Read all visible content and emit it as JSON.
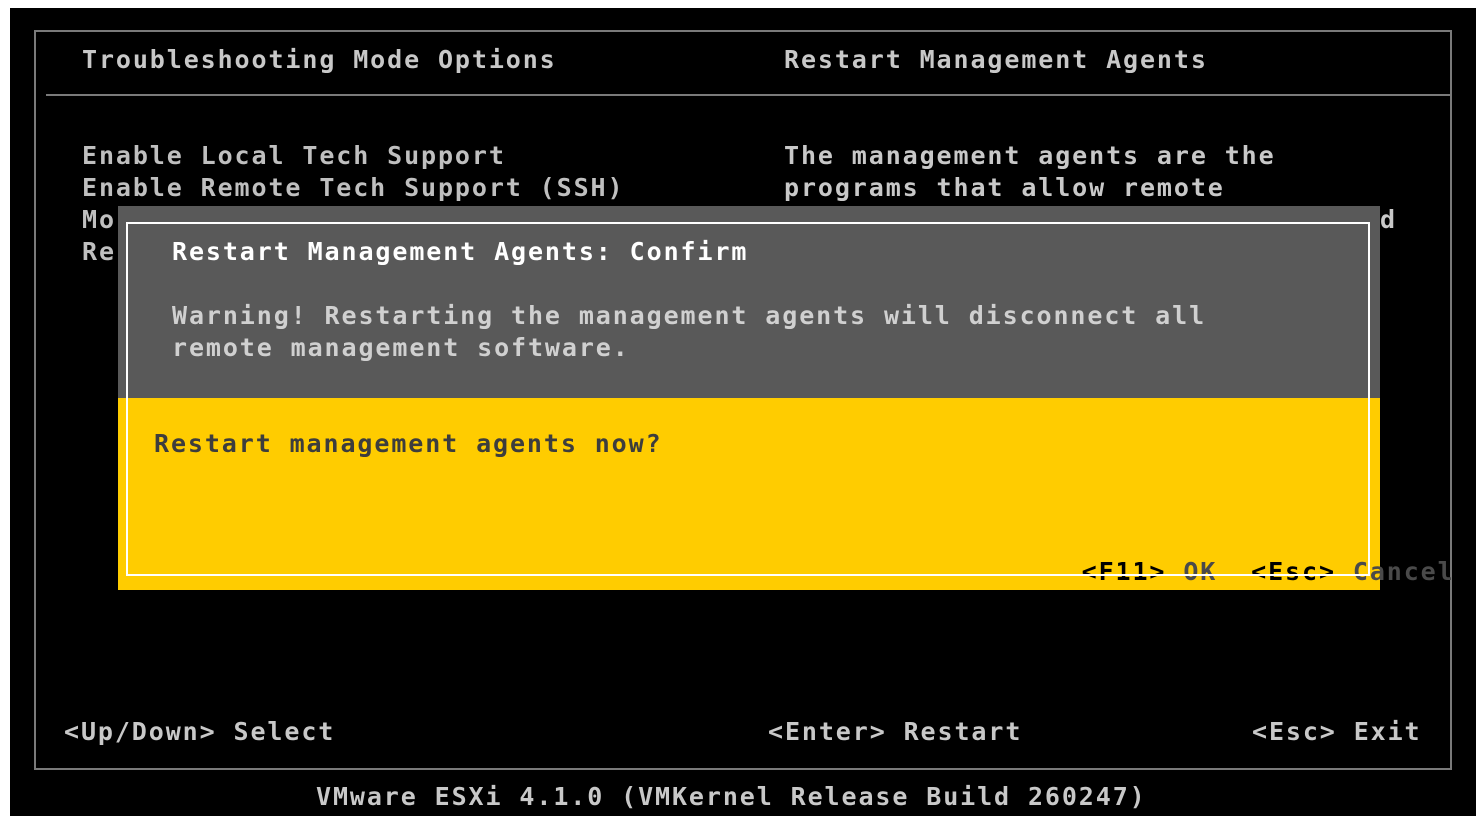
{
  "header": {
    "left_title": "Troubleshooting Mode Options",
    "right_title": "Restart Management Agents"
  },
  "menu": {
    "items": [
      {
        "label": "Enable Local Tech Support"
      },
      {
        "label": "Enable Remote Tech Support (SSH)"
      },
      {
        "label": "Mo"
      },
      {
        "label": "Re"
      }
    ]
  },
  "description": {
    "lines": [
      "The management agents are the",
      "programs that allow remote",
      "d"
    ]
  },
  "dialog": {
    "title": "Restart Management Agents: Confirm",
    "warning_line1": "Warning! Restarting the management agents will disconnect all",
    "warning_line2": "remote management software.",
    "question": "Restart management agents now?",
    "ok_key": "<F11>",
    "ok_label": "OK",
    "cancel_key": "<Esc>",
    "cancel_label": "Cancel"
  },
  "footer": {
    "select_hint": "<Up/Down> Select",
    "restart_hint": "<Enter> Restart",
    "exit_hint": "<Esc> Exit"
  },
  "version": "VMware ESXi 4.1.0 (VMKernel Release Build 260247)",
  "colors": {
    "background": "#000000",
    "dialog_top": "#595959",
    "dialog_bottom": "#ffcc00",
    "text": "#bfbfbf"
  }
}
